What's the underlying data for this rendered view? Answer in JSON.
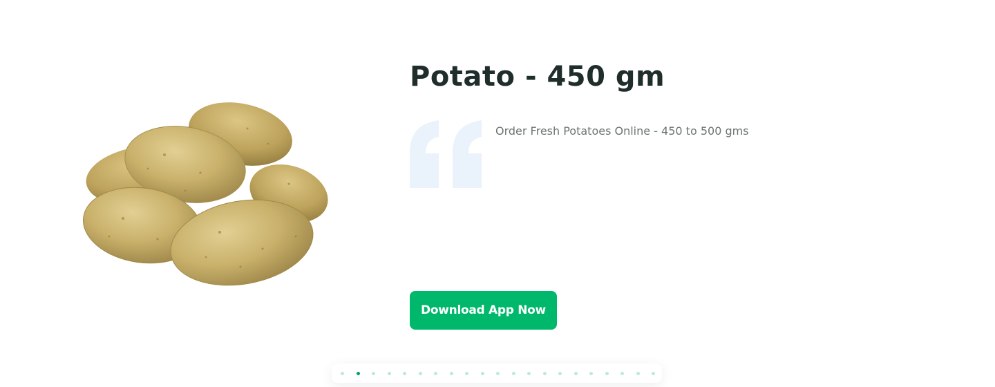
{
  "product": {
    "title": "Potato - 450 gm",
    "description": "Order Fresh Potatoes Online - 450 to 500 gms",
    "image": "potatoes-pile-photo"
  },
  "cta": {
    "label": "Download App Now"
  },
  "carousel": {
    "total_slides": 21,
    "active_index": 1
  },
  "colors": {
    "accent": "#00b86b",
    "title": "#1f2d2b",
    "body_text": "#6b7570",
    "quote_mark": "#eaf2fb",
    "dot_inactive": "#bfe9d7",
    "dot_active": "#00a55f"
  }
}
